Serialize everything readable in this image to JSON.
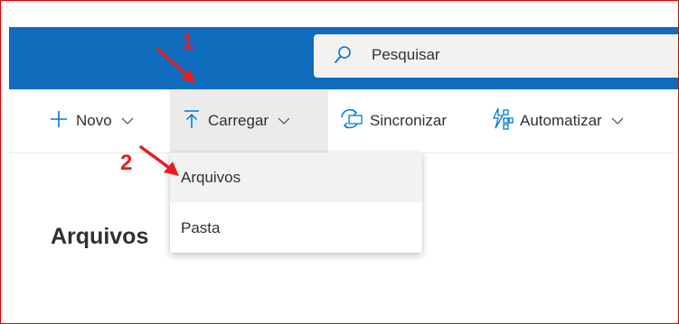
{
  "search": {
    "placeholder": "Pesquisar",
    "icon": "search-icon"
  },
  "commands": [
    {
      "label": "Novo",
      "icon": "plus-icon"
    },
    {
      "label": "Carregar",
      "icon": "upload-icon"
    },
    {
      "label": "Sincronizar",
      "icon": "sync-icon"
    },
    {
      "label": "Automatizar",
      "icon": "automate-icon"
    }
  ],
  "upload_menu": {
    "items": [
      "Arquivos",
      "Pasta"
    ]
  },
  "main": {
    "title": "Arquivos"
  },
  "annotations": {
    "step1": "1",
    "step2": "2"
  },
  "colors": {
    "brand": "#0f6cbd",
    "accent_blue": "#0078d4",
    "annotation": "#e51c23"
  }
}
